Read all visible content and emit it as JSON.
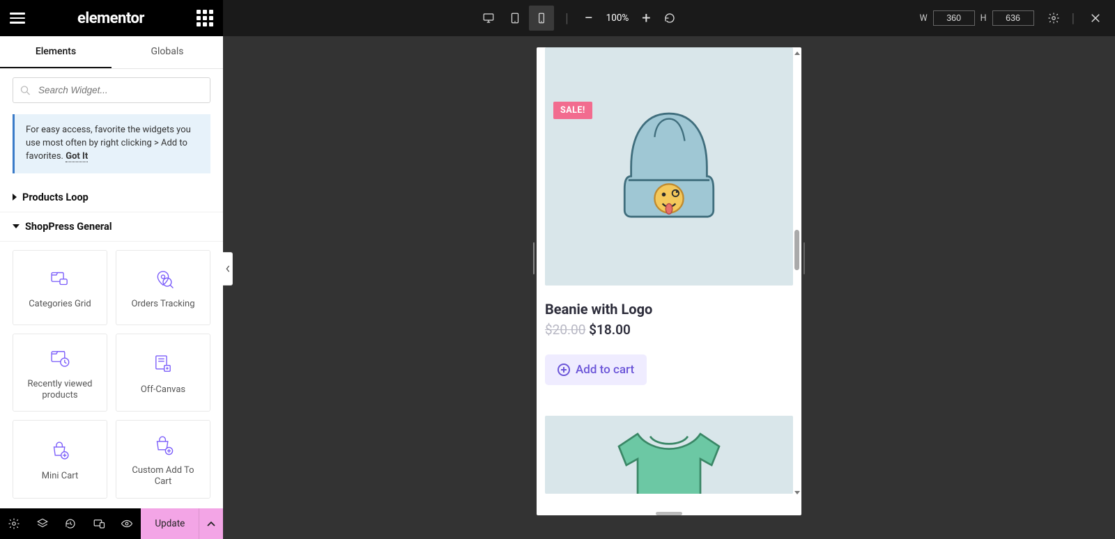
{
  "header": {
    "logo_text": "elementor"
  },
  "tabs": {
    "elements": "Elements",
    "globals": "Globals"
  },
  "search": {
    "placeholder": "Search Widget..."
  },
  "info": {
    "text": "For easy access, favorite the widgets you use most often by right clicking > Add to favorites.",
    "got_it": "Got It"
  },
  "categories": {
    "products_loop": "Products Loop",
    "shoppress_general": "ShopPress General"
  },
  "widgets": {
    "categories_grid": "Categories Grid",
    "orders_tracking": "Orders Tracking",
    "recently_viewed": "Recently viewed products",
    "off_canvas": "Off-Canvas",
    "mini_cart": "Mini Cart",
    "custom_atc": "Custom Add To Cart"
  },
  "footer": {
    "update": "Update"
  },
  "topbar": {
    "zoom": "100%",
    "w_label": "W",
    "h_label": "H",
    "width": "360",
    "height": "636"
  },
  "preview": {
    "product1": {
      "sale_badge": "SALE!",
      "title": "Beanie with Logo",
      "price_old": "$20.00",
      "price_new": "$18.00",
      "atc_label": "Add to cart"
    }
  }
}
